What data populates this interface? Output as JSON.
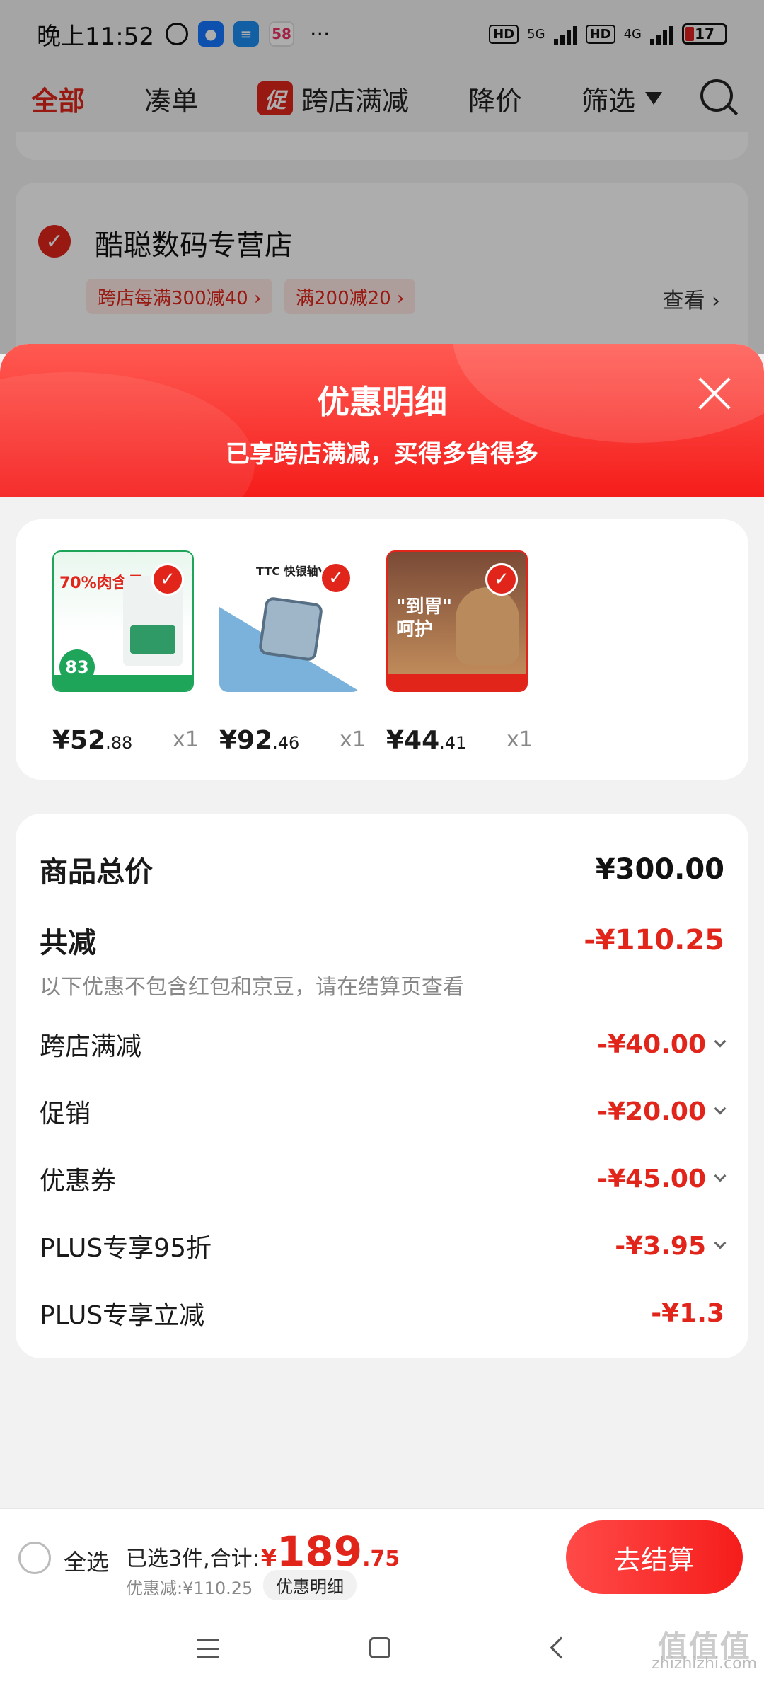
{
  "status_bar": {
    "time": "晚上11:52",
    "app_icon_58": "58",
    "more": "···",
    "hd1": "HD",
    "net1": "5G",
    "hd2": "HD",
    "net2": "4G",
    "battery": "17"
  },
  "tabs": [
    {
      "label": "全部",
      "active": true
    },
    {
      "label": "凑单"
    },
    {
      "label": "跨店满减",
      "badge": "促"
    },
    {
      "label": "降价"
    },
    {
      "label": "筛选"
    }
  ],
  "shop": {
    "name": "酷聪数码专营店",
    "tags": [
      "跨店每满300减40 ›",
      "满200减20 ›"
    ],
    "view_label": "查看 ›"
  },
  "sheet": {
    "title": "优惠明细",
    "subtitle": "已享跨店满减，买得多省得多"
  },
  "products": [
    {
      "price_int": "¥52",
      "price_dec": ".88",
      "qty": "x1",
      "img_text": "70%肉含量",
      "badge": "83"
    },
    {
      "price_int": "¥92",
      "price_dec": ".46",
      "qty": "x1",
      "img_text": "TTC 快银轴V"
    },
    {
      "price_int": "¥44",
      "price_dec": ".41",
      "qty": "x1",
      "img_text": "\"到胃\"\n呵护"
    }
  ],
  "summary": {
    "total_label": "商品总价",
    "total_value": "¥300.00",
    "reduce_label": "共减",
    "reduce_value": "-¥110.25",
    "note": "以下优惠不包含红包和京豆，请在结算页查看",
    "items": [
      {
        "label": "跨店满减",
        "value": "-¥40.00"
      },
      {
        "label": "促销",
        "value": "-¥20.00"
      },
      {
        "label": "优惠券",
        "value": "-¥45.00"
      },
      {
        "label": "PLUS专享95折",
        "value": "-¥3.95"
      },
      {
        "label": "PLUS专享立减",
        "value": "-¥1.3"
      }
    ]
  },
  "bottom_bar": {
    "select_all": "全选",
    "selected_text": "已选3件,合计:",
    "yen": "¥",
    "total_int": "189",
    "total_dec": ".75",
    "discount": "优惠减:¥110.25",
    "discount_detail": "优惠明细",
    "checkout": "去结算"
  },
  "watermark": {
    "logo": "值值值",
    "site": "zhizhizhi.com"
  },
  "colors": {
    "accent": "#e1251b",
    "header_gradient_top": "#ff5a52",
    "header_gradient_bottom": "#f51d1b"
  }
}
